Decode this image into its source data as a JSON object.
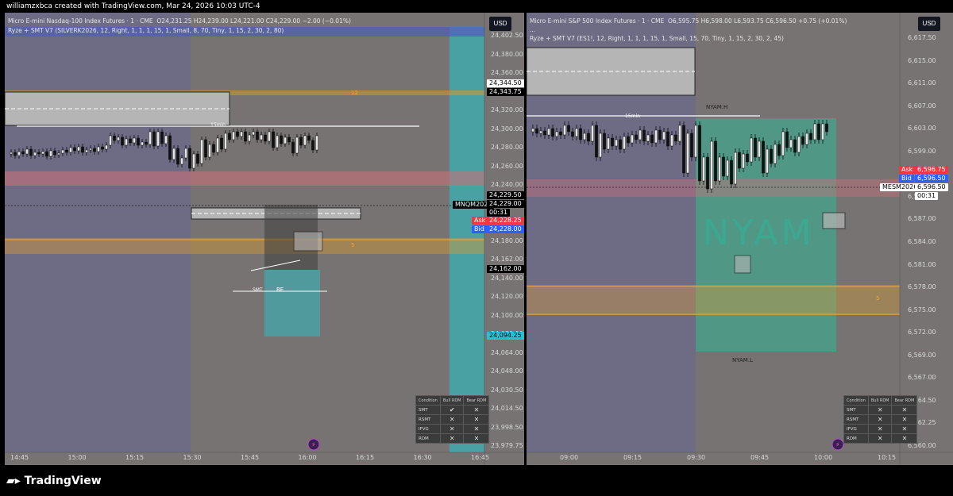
{
  "header": {
    "title": "williamzxbca created with TradingView.com, Mar 24, 2026 10:03 UTC-4"
  },
  "left": {
    "symbol": "Micro E-mini Nasdaq-100 Index Futures · 1 · CME",
    "ohlc": "O24,231.25 H24,239.00 L24,221.00 C24,229.00 −2.00 (−0.01%)",
    "indicator": "Ryze + SMT V7 (SILVERK2026, 12, Right, 1, 1, 1, 15, 1, Small, 8, 70, Tiny, 1, 15, 2, 30, 2, 80)",
    "currency": "USD",
    "prices": [
      "24,402.50",
      "24,380.00",
      "24,360.00",
      "24,340.00",
      "24,320.00",
      "24,300.00",
      "24,280.00",
      "24,260.00",
      "24,240.00",
      "24,220.00",
      "24,200.00",
      "24,180.00",
      "24,162.00",
      "24,140.00",
      "24,120.00",
      "24,100.00",
      "24,080.00",
      "24,064.00",
      "24,048.00",
      "24,030.50",
      "24,014.50",
      "23,998.50",
      "23,979.75"
    ],
    "tag_3445": "24,344.50",
    "tag_3437": "24,343.75",
    "tag_current": "24,229.50",
    "tag_current2": "24,229.00",
    "countdown": "00:31",
    "symbol_tag": "MNQM2026",
    "ask_label": "Ask",
    "ask": "24,228.25",
    "bid_label": "Bid",
    "bid": "24,228.00",
    "tag_low": "24,162.00",
    "tag_cyan": "24,094.25",
    "times": [
      "14:45",
      "15:00",
      "15:15",
      "15:30",
      "15:45",
      "16:00",
      "16:15",
      "16:30",
      "16:45"
    ],
    "label_15min": "15min",
    "label_12": "12",
    "label_5": "5",
    "label_smt": "SMT",
    "label_be": "BE",
    "table": {
      "headers": [
        "Condition",
        "Bull RDM",
        "Bear RDM"
      ],
      "rows": [
        {
          "name": "SMT",
          "bull": "✔",
          "bear": "✕"
        },
        {
          "name": "RSMT",
          "bull": "✕",
          "bear": "✕"
        },
        {
          "name": "IFVG",
          "bull": "✕",
          "bear": "✕"
        },
        {
          "name": "RDM",
          "bull": "✕",
          "bear": "✕"
        }
      ]
    }
  },
  "right": {
    "symbol": "Micro E-mini S&P 500 Index Futures · 1 · CME",
    "ohlc": "O6,595.75 H6,598.00 L6,593.75 C6,596.50 +0.75 (+0.01%)",
    "dots": "...",
    "indicator": "Ryze + SMT V7 (ES1!, 12, Right, 1, 1, 1, 15, 1, Small, 15, 70, Tiny, 1, 15, 2, 30, 2, 45)",
    "currency": "USD",
    "prices": [
      "6,617.50",
      "6,615.00",
      "6,611.00",
      "6,607.00",
      "6,603.00",
      "6,599.00",
      "6,595.00",
      "6,591.00",
      "6,587.00",
      "6,584.00",
      "6,581.00",
      "6,578.00",
      "6,575.00",
      "6,572.00",
      "6,569.00",
      "6,567.00",
      "6,564.50",
      "6,562.25",
      "6,560.00"
    ],
    "ask_label": "Ask",
    "ask": "6,596.75",
    "bid_label": "Bid",
    "bid": "6,596.50",
    "symbol_tag": "MESM2026",
    "current": "6,596.50",
    "countdown": "00:31",
    "times": [
      "09:00",
      "09:15",
      "09:30",
      "09:45",
      "10:00",
      "10:15"
    ],
    "label_15min": "15min",
    "label_nyamh": "NYAM.H",
    "label_nyaml": "NYAM.L",
    "label_nyam": "NYAM",
    "label_5": "5",
    "table": {
      "headers": [
        "Condition",
        "Bull RDM",
        "Bear RDM"
      ],
      "rows": [
        {
          "name": "SMT",
          "bull": "✕",
          "bear": "✕"
        },
        {
          "name": "RSMT",
          "bull": "✕",
          "bear": "✕"
        },
        {
          "name": "IFVG",
          "bull": "✕",
          "bear": "✕"
        },
        {
          "name": "RDM",
          "bull": "✕",
          "bear": "✕"
        }
      ]
    }
  },
  "footer": {
    "brand": "TradingView"
  },
  "colors": {
    "bg": "#767372",
    "purple": "#6c6b8a",
    "teal": "#4aa1a4",
    "ask": "#f23645",
    "bid": "#2962ff",
    "orange": "#f5a623",
    "cyan": "#22c1d6"
  }
}
